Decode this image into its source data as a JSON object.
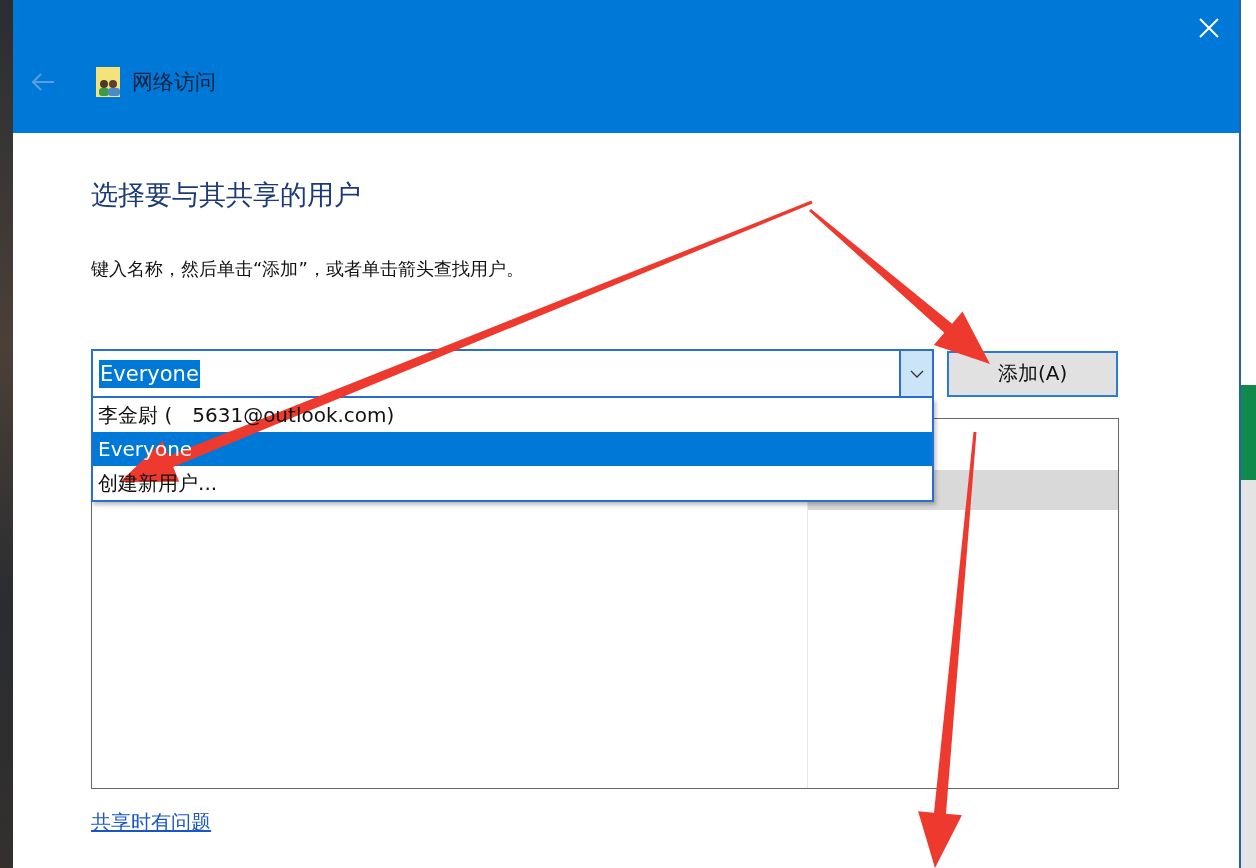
{
  "window": {
    "title": "网络访问"
  },
  "heading": "选择要与其共享的用户",
  "instruction": "键入名称，然后单击“添加”，或者单击箭头查找用户。",
  "name_combo": {
    "value": "Everyone",
    "text_selected": true,
    "expanded": true
  },
  "dropdown_items": [
    {
      "label_parts": [
        "李金尉 (",
        "5631@outlook.com)"
      ],
      "selected": false
    },
    {
      "label_parts": [
        "Everyone"
      ],
      "selected": true
    },
    {
      "label_parts": [
        "创建新用户..."
      ],
      "selected": false
    }
  ],
  "add_button": "添加(A)",
  "help_link": "共享时有问题"
}
